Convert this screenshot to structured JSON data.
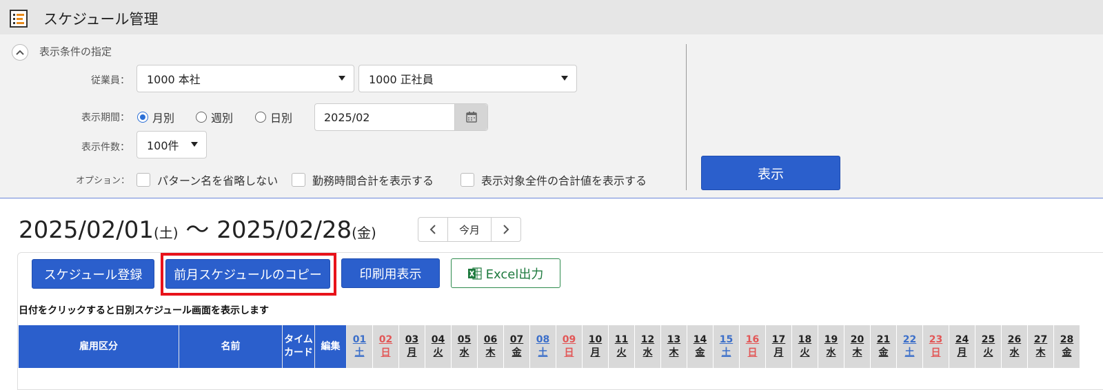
{
  "app": {
    "title": "スケジュール管理"
  },
  "conditions": {
    "section_title": "表示条件の指定",
    "employee_label": "従業員：",
    "office_value": "1000 本社",
    "employment_value": "1000 正社員",
    "period_label": "表示期間：",
    "period_options": [
      "月別",
      "週別",
      "日別"
    ],
    "period_selected": "月別",
    "date_value": "2025/02",
    "count_label": "表示件数：",
    "count_value": "100件",
    "option_label": "オプション：",
    "options": [
      "パターン名を省略しない",
      "勤務時間合計を表示する",
      "表示対象全件の合計値を表示する"
    ],
    "show_button": "表示"
  },
  "range": {
    "start": "2025/02/01",
    "start_dow": "(土)",
    "separator": "〜",
    "end": "2025/02/28",
    "end_dow": "(金)"
  },
  "nav": {
    "today_label": "今月"
  },
  "actions": {
    "register": "スケジュール登録",
    "copy_prev": "前月スケジュールのコピー",
    "print": "印刷用表示",
    "excel": "Excel出力"
  },
  "hint": "日付をクリックすると日別スケジュール画面を表示します",
  "table": {
    "headers": {
      "employment": "雇用区分",
      "name": "名前",
      "timecard_1": "タイム",
      "timecard_2": "カード",
      "edit": "編集"
    },
    "days": [
      {
        "d": "01",
        "w": "土"
      },
      {
        "d": "02",
        "w": "日"
      },
      {
        "d": "03",
        "w": "月"
      },
      {
        "d": "04",
        "w": "火"
      },
      {
        "d": "05",
        "w": "水"
      },
      {
        "d": "06",
        "w": "木"
      },
      {
        "d": "07",
        "w": "金"
      },
      {
        "d": "08",
        "w": "土"
      },
      {
        "d": "09",
        "w": "日"
      },
      {
        "d": "10",
        "w": "月"
      },
      {
        "d": "11",
        "w": "火"
      },
      {
        "d": "12",
        "w": "水"
      },
      {
        "d": "13",
        "w": "木"
      },
      {
        "d": "14",
        "w": "金"
      },
      {
        "d": "15",
        "w": "土"
      },
      {
        "d": "16",
        "w": "日"
      },
      {
        "d": "17",
        "w": "月"
      },
      {
        "d": "18",
        "w": "火"
      },
      {
        "d": "19",
        "w": "水"
      },
      {
        "d": "20",
        "w": "木"
      },
      {
        "d": "21",
        "w": "金"
      },
      {
        "d": "22",
        "w": "土"
      },
      {
        "d": "23",
        "w": "日"
      },
      {
        "d": "24",
        "w": "月"
      },
      {
        "d": "25",
        "w": "火"
      },
      {
        "d": "26",
        "w": "水"
      },
      {
        "d": "27",
        "w": "木"
      },
      {
        "d": "28",
        "w": "金"
      }
    ]
  },
  "colors": {
    "primary": "#2b5fcc",
    "saturday": "#3b6ec9",
    "sunday": "#e25656",
    "highlight": "#e8121a",
    "excel": "#1e7a3e"
  }
}
